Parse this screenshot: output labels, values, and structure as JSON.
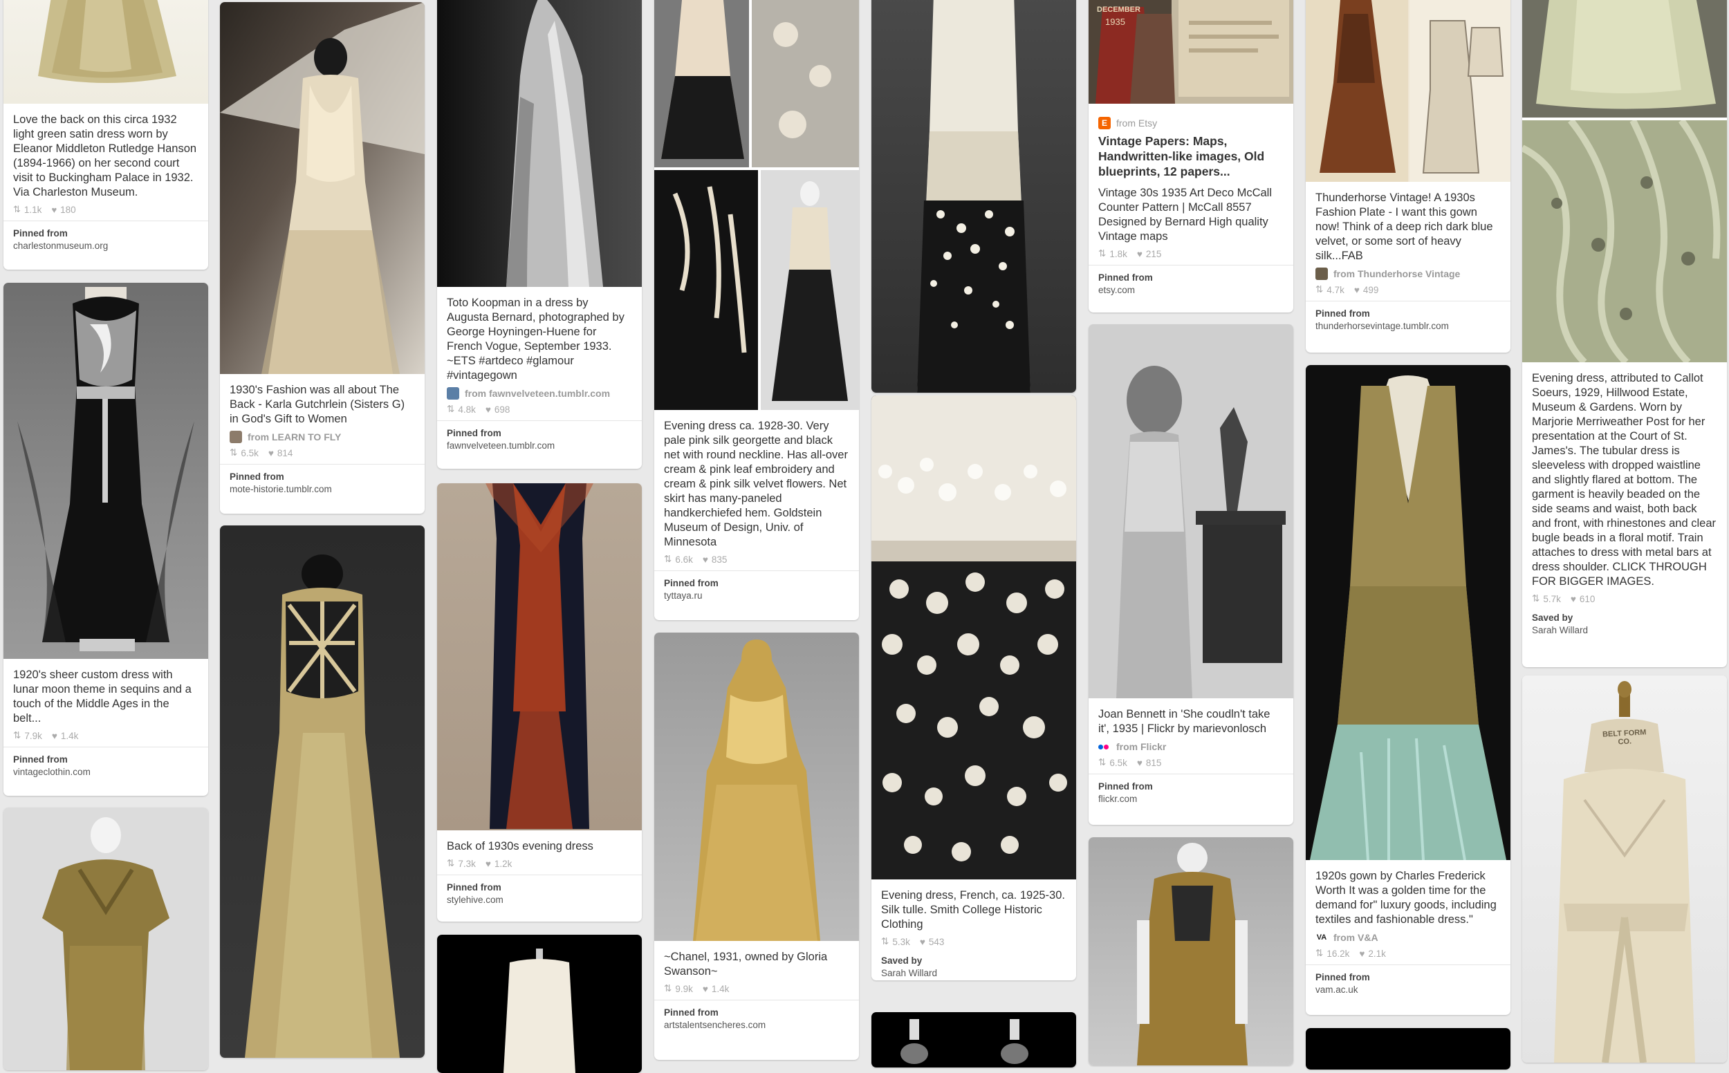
{
  "pins": [
    {
      "id": "p1",
      "desc": "Love the back on this circa 1932 light green satin dress worn by Eleanor Middleton Rutledge Hanson (1894-1966) on her second court visit to Buckingham Palace in 1932. Via Charleston Museum.",
      "repins": "1.1k",
      "likes": "180",
      "foot1": "Pinned from",
      "foot2": "charlestonmuseum.org"
    },
    {
      "id": "p2",
      "desc": "1920's sheer custom dress with lunar moon theme in sequins and a touch of the Middle Ages in the belt...",
      "repins": "7.9k",
      "likes": "1.4k",
      "foot1": "Pinned from",
      "foot2": "vintageclothin.com"
    },
    {
      "id": "p4",
      "desc": "1930's Fashion was all about The Back - Karla Gutchrlein (Sisters G) in God's Gift to Women",
      "source": "from LEARN TO FLY",
      "repins": "6.5k",
      "likes": "814",
      "foot1": "Pinned from",
      "foot2": "mote-historie.tumblr.com"
    },
    {
      "id": "p6",
      "desc": "Toto Koopman in a dress by Augusta Bernard, photographed by George Hoyningen-Huene for French Vogue, September 1933. ~ETS #artdeco #glamour #vintagegown",
      "source": "from fawnvelveteen.tumblr.com",
      "repins": "4.8k",
      "likes": "698",
      "foot1": "Pinned from",
      "foot2": "fawnvelveteen.tumblr.com"
    },
    {
      "id": "p7",
      "desc": "Back of 1930s evening dress",
      "repins": "7.3k",
      "likes": "1.2k",
      "foot1": "Pinned from",
      "foot2": "stylehive.com"
    },
    {
      "id": "p9",
      "desc": "Evening dress ca. 1928-30. Very pale pink silk georgette and black net with round neckline. Has all-over cream & pink leaf embroidery and cream & pink silk velvet flowers. Net skirt has many-paneled handkerchiefed hem. Goldstein Museum of Design, Univ. of Minnesota",
      "repins": "6.6k",
      "likes": "835",
      "foot1": "Pinned from",
      "foot2": "tyttaya.ru"
    },
    {
      "id": "p10",
      "desc": "~Chanel, 1931, owned by Gloria Swanson~",
      "repins": "9.9k",
      "likes": "1.4k",
      "foot1": "Pinned from",
      "foot2": "artstalentsencheres.com"
    },
    {
      "id": "p12",
      "desc": "Evening dress, French, ca. 1925-30. Silk tulle. Smith College Historic Clothing",
      "repins": "5.3k",
      "likes": "543",
      "foot1": "Saved by",
      "foot2": "Sarah Willard"
    },
    {
      "id": "p14",
      "source": "from Etsy",
      "title": "Vintage Papers: Maps, Handwritten-like images, Old blueprints, 12 papers...",
      "desc": "Vintage 30s 1935 Art Deco McCall Counter Pattern | McCall 8557 Designed by Bernard High quality Vintage maps",
      "repins": "1.8k",
      "likes": "215",
      "foot1": "Pinned from",
      "foot2": "etsy.com"
    },
    {
      "id": "p15",
      "desc": "Joan Bennett in 'She coudln't take it', 1935 | Flickr by marievonlosch",
      "source": "from Flickr",
      "repins": "6.5k",
      "likes": "815",
      "foot1": "Pinned from",
      "foot2": "flickr.com"
    },
    {
      "id": "p17",
      "desc": "Thunderhorse Vintage! A 1930s Fashion Plate - I want this gown now! Think of a deep rich dark blue velvet, or some sort of heavy silk...FAB",
      "source": "from Thunderhorse Vintage",
      "repins": "4.7k",
      "likes": "499",
      "foot1": "Pinned from",
      "foot2": "thunderhorsevintage.tumblr.com"
    },
    {
      "id": "p18",
      "desc": "1920s gown by Charles Frederick Worth It was a golden time for the demand for\" luxury goods, including textiles and fashionable dress.\"",
      "source": "from V&A",
      "repins": "16.2k",
      "likes": "2.1k",
      "foot1": "Pinned from",
      "foot2": "vam.ac.uk"
    },
    {
      "id": "p21",
      "desc": "Evening dress, attributed to Callot Soeurs, 1929, Hillwood Estate, Museum & Gardens. Worn by Marjorie Merriweather Post for her presentation at the Court of St. James's. The tubular dress is sleeveless with dropped waistline and slightly flared at bottom. The garment is heavily beaded on the side seams and waist, both back and front, with rhinestones and clear bugle beads in a floral motif. Train attaches to dress with metal bars at dress shoulder. CLICK THROUGH FOR BIGGER IMAGES.",
      "repins": "5.7k",
      "likes": "610",
      "foot1": "Saved by",
      "foot2": "Sarah Willard"
    }
  ],
  "image_text": {
    "pattern_month": "DECEMBER",
    "pattern_year": "1935",
    "form_label": "BELT FORM CO."
  },
  "icons": {
    "repin": "repin-icon",
    "like": "heart-icon"
  }
}
